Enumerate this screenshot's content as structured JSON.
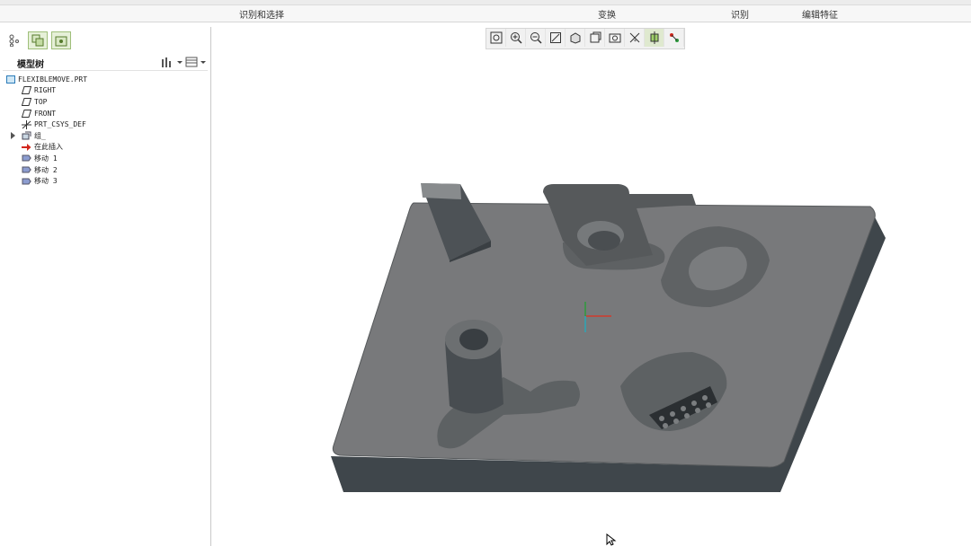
{
  "ribbon": {
    "groups": [
      {
        "id": "select",
        "label": "识别和选择"
      },
      {
        "id": "transform",
        "label": "变换"
      },
      {
        "id": "identify",
        "label": "识别"
      },
      {
        "id": "edit",
        "label": "编辑特征"
      }
    ]
  },
  "tree": {
    "title": "模型树",
    "items": [
      {
        "label": "FLEXIBLEMOVE.PRT",
        "icon": "part-icon"
      },
      {
        "label": "RIGHT",
        "icon": "datum-plane-icon"
      },
      {
        "label": "TOP",
        "icon": "datum-plane-icon"
      },
      {
        "label": "FRONT",
        "icon": "datum-plane-icon"
      },
      {
        "label": "PRT_CSYS_DEF",
        "icon": "csys-icon"
      },
      {
        "label": "组_",
        "icon": "group-icon"
      },
      {
        "label": "在此插入",
        "icon": "insert-here-icon"
      },
      {
        "label": "移动 1",
        "icon": "move-feature-icon"
      },
      {
        "label": "移动 2",
        "icon": "move-feature-icon"
      },
      {
        "label": "移动 3",
        "icon": "move-feature-icon"
      }
    ]
  },
  "view_toolbar": {
    "buttons": [
      "refit-icon",
      "zoom-in-icon",
      "zoom-out-icon",
      "repaint-icon",
      "display-style-icon",
      "saved-views-icon",
      "view-manager-icon",
      "datum-display-icon",
      "spin-center-icon",
      "annotation-display-icon"
    ],
    "active": [
      "spin-center-icon"
    ]
  },
  "colors": {
    "model_top": "#76797b",
    "model_side": "#41474c",
    "selection_green": "#9fbf7a"
  }
}
